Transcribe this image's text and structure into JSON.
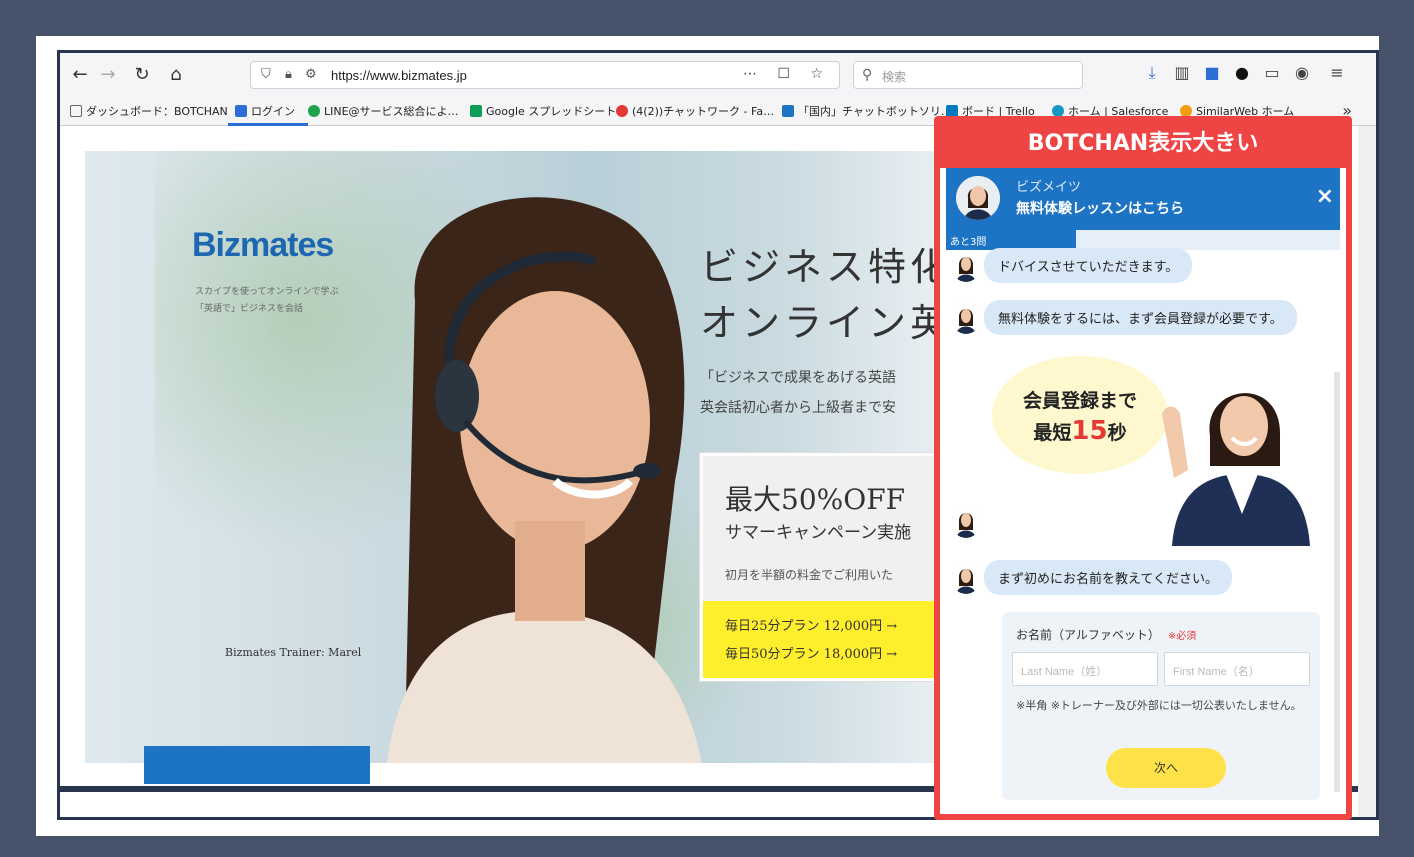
{
  "browser": {
    "url": "https://www.bizmates.jp",
    "search_placeholder": "検索",
    "bookmarks": [
      "ダッシュボード：BOTCHAN",
      "ログイン",
      "LINE@サービス総合によ…",
      "Google スプレッドシート",
      "(4(2))チャットワーク - Fa…",
      "「国内」チャットボットソリ…",
      "ボード | Trello",
      "ホーム | Salesforce",
      "SimilarWeb ホーム"
    ],
    "more": "»"
  },
  "hero": {
    "logo": "Bizmates",
    "logo_sub_1": "スカイプを使ってオンラインで学ぶ",
    "logo_sub_2": "「英語で」ビジネスを会話",
    "title_1": "ビジネス特化",
    "title_2": "オンライン英",
    "sub_1": "「ビジネスで成果をあげる英語",
    "sub_2": "英会話初心者から上級者まで安",
    "offer_title": "最大50%OFF",
    "offer_sub": "サマーキャンペーン実施",
    "offer_note": "初月を半額の料金でご利用いた",
    "plan_1": "毎日25分プラン 12,000円 →",
    "plan_2": "毎日50分プラン 18,000円 →",
    "trainer": "Bizmates Trainer: Marel"
  },
  "chat": {
    "banner": "BOTCHAN表示大きい",
    "name": "ビズメイツ",
    "headline": "無料体験レッスンはこちら",
    "close": "×",
    "progress_label": "あと3問",
    "progress": 0.33,
    "messages": [
      "ドバイスさせていただきます。",
      "無料体験をするには、まず会員登録が必要です。",
      "まず初めにお名前を教えてください。"
    ],
    "promo_line1": "会員登録まで",
    "promo_prefix": "最短",
    "promo_num": "15",
    "promo_suffix": "秒",
    "form_label": "お名前（アルファベット）",
    "form_required": "※必須",
    "last_name_placeholder": "Last Name（姓）",
    "first_name_placeholder": "First Name（名）",
    "form_note": "※半角 ※トレーナー及び外部には一切公表いたしません。",
    "next_button": "次へ"
  },
  "colors": {
    "accent_red": "#ef4444",
    "brand_blue": "#1d74c4",
    "cta_yellow": "#ffe14a"
  }
}
